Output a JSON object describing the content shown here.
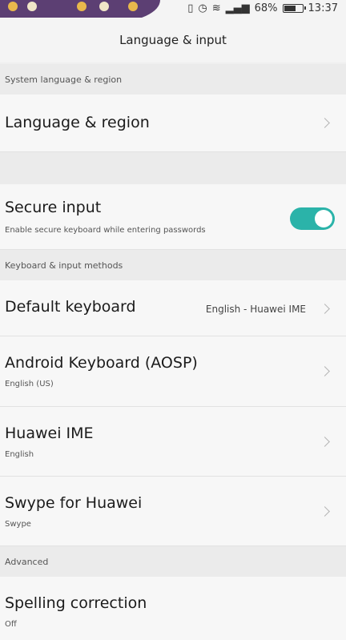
{
  "status_bar": {
    "battery": "68%",
    "battery_level": 0.68,
    "time": "13:37",
    "icons": [
      "vibrate-icon",
      "alarm-icon",
      "wifi-icon",
      "signal-icon",
      "battery-icon"
    ]
  },
  "header": {
    "title": "Language & input"
  },
  "sections": {
    "system": "System language & region",
    "keyboard": "Keyboard & input methods",
    "advanced": "Advanced"
  },
  "rows": {
    "language_region": {
      "title": "Language & region"
    },
    "secure_input": {
      "title": "Secure input",
      "subtitle": "Enable secure keyboard while entering passwords",
      "enabled": true
    },
    "default_keyboard": {
      "title": "Default keyboard",
      "value": "English - Huawei IME"
    },
    "aosp": {
      "title": "Android Keyboard (AOSP)",
      "subtitle": "English (US)"
    },
    "huawei_ime": {
      "title": "Huawei IME",
      "subtitle": "English"
    },
    "swype": {
      "title": "Swype for Huawei",
      "subtitle": "Swype"
    },
    "spelling": {
      "title": "Spelling correction",
      "subtitle": "Off"
    }
  },
  "colors": {
    "toggle_on": "#2bb3a9",
    "background": "#efefef",
    "section_bg": "#ebebeb",
    "row_bg": "#f7f7f7"
  }
}
